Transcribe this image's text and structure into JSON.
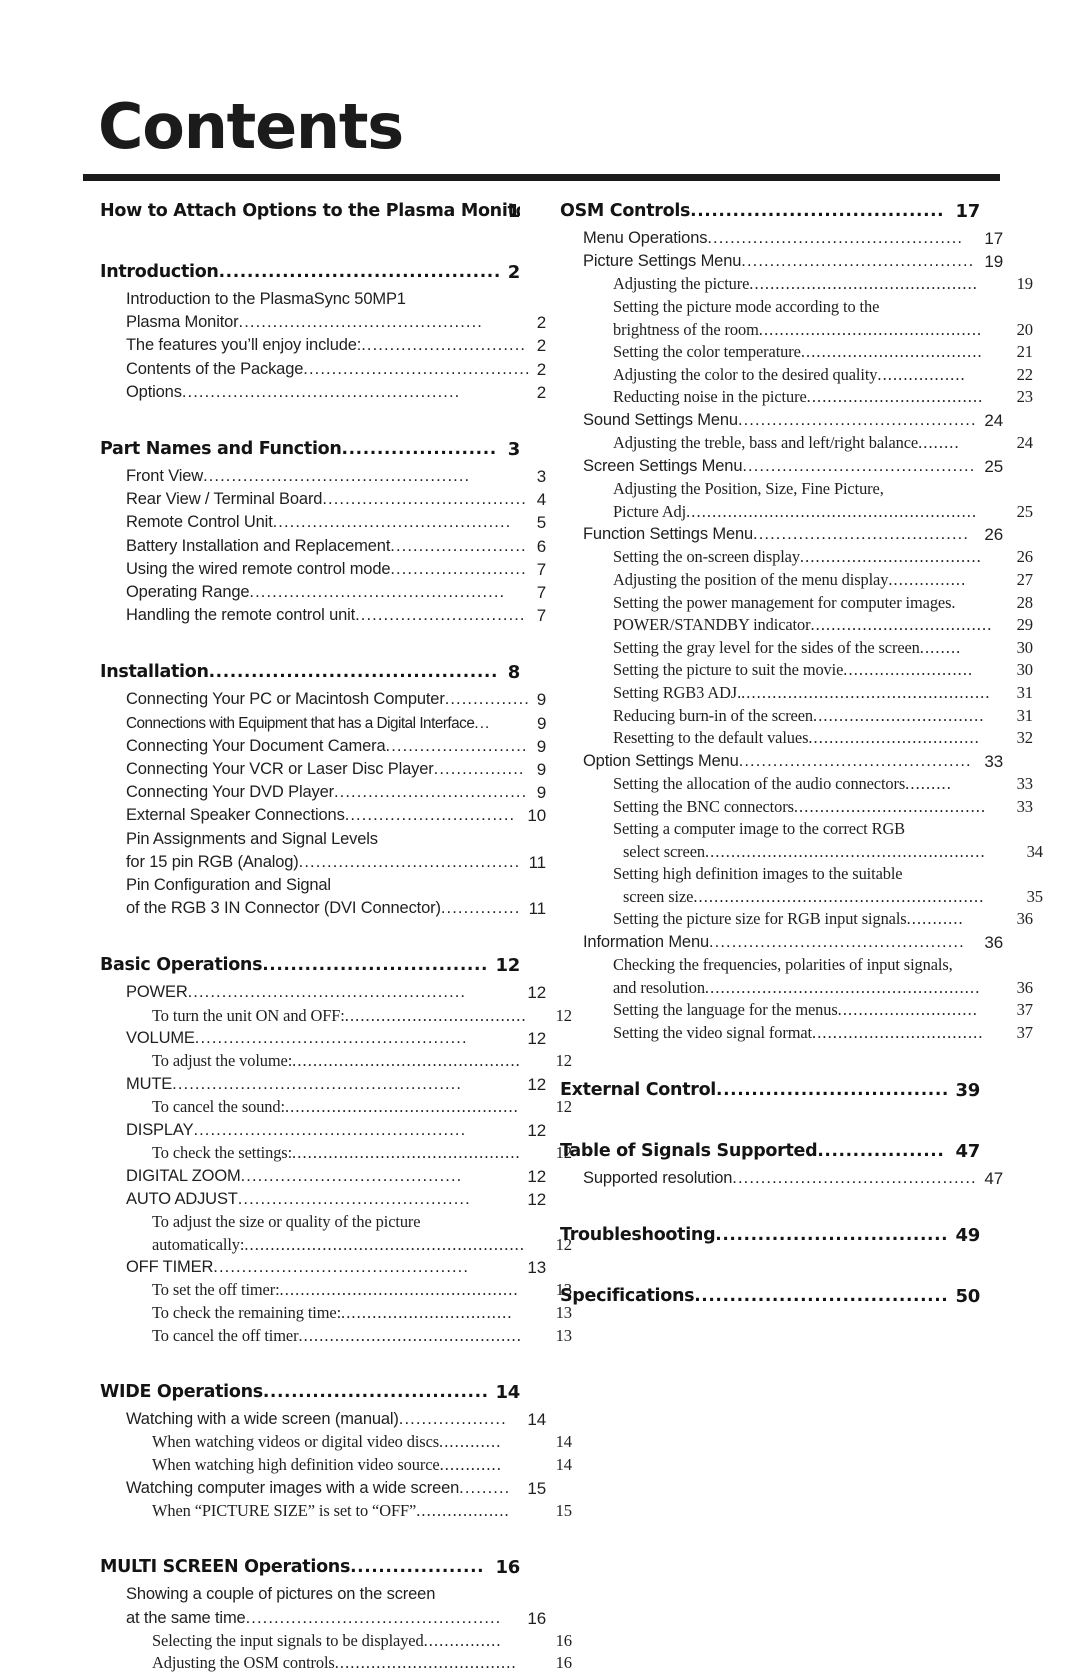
{
  "document": {
    "title": "Contents"
  },
  "columns": {
    "left": [
      {
        "level": 1,
        "text": "How to Attach Options to the Plasma Monitor",
        "page": "1",
        "dots": "...."
      },
      {
        "level": 1,
        "text": "Introduction",
        "page": "2",
        "dots": "................................................."
      },
      {
        "level": 2,
        "text": "Introduction to the PlasmaSync 50MP1",
        "page": "",
        "dots": ""
      },
      {
        "level": 2,
        "text": "Plasma Monitor",
        "page": "2",
        "dots": "..........................................."
      },
      {
        "level": 2,
        "text": "The features you’ll enjoy include:",
        "page": "2",
        "dots": "..............................."
      },
      {
        "level": 2,
        "text": "Contents of the Package",
        "page": "2",
        "dots": "........................................"
      },
      {
        "level": 2,
        "text": "Options",
        "page": "2",
        "dots": "................................................."
      },
      {
        "level": 1,
        "text": "Part Names and Function",
        "page": "3",
        "dots": "................................"
      },
      {
        "level": 2,
        "text": "Front View",
        "page": "3",
        "dots": "..............................................."
      },
      {
        "level": 2,
        "text": "Rear View / Terminal Board",
        "page": "4",
        "dots": "...................................."
      },
      {
        "level": 2,
        "text": "Remote Control Unit",
        "page": "5",
        "dots": ".........................................."
      },
      {
        "level": 2,
        "text": "Battery Installation and Replacement",
        "page": "6",
        "dots": "........................"
      },
      {
        "level": 2,
        "text": "Using the wired remote control mode",
        "page": "7",
        "dots": "........................"
      },
      {
        "level": 2,
        "text": "Operating Range",
        "page": "7",
        "dots": "............................................."
      },
      {
        "level": 2,
        "text": "Handling the remote control unit",
        "page": "7",
        "dots": "..............................."
      },
      {
        "level": 1,
        "text": "Installation",
        "page": "8",
        "dots": ".................................................."
      },
      {
        "level": 2,
        "text": "Connecting Your PC or Macintosh Computer",
        "page": "9",
        "dots": "..............."
      },
      {
        "level": 2,
        "text": "Connections with Equipment that has a Digital Interface",
        "page": "9",
        "dots": "...",
        "small": true
      },
      {
        "level": 2,
        "text": "Connecting Your Document Camera",
        "page": "9",
        "dots": ".........................."
      },
      {
        "level": 2,
        "text": "Connecting Your VCR or Laser Disc Player",
        "page": "9",
        "dots": "................."
      },
      {
        "level": 2,
        "text": "Connecting Your DVD Player",
        "page": "9",
        "dots": "...................................."
      },
      {
        "level": 2,
        "text": "External Speaker Connections",
        "page": "10",
        "dots": "................................."
      },
      {
        "level": 2,
        "text": "Pin Assignments and Signal Levels",
        "page": "",
        "dots": ""
      },
      {
        "level": 2,
        "text": "for 15 pin RGB (Analog)",
        "page": "11",
        "dots": "........................................"
      },
      {
        "level": 2,
        "text": "Pin Configuration and Signal",
        "page": "",
        "dots": ""
      },
      {
        "level": 2,
        "text": "of the RGB 3 IN Connector (DVI Connector)",
        "page": "11",
        "dots": ".............."
      },
      {
        "level": 1,
        "text": "Basic Operations",
        "page": "12",
        "dots": "..........................................."
      },
      {
        "level": 2,
        "text": "POWER",
        "page": "12",
        "dots": "................................................."
      },
      {
        "level": 3,
        "text": "To turn the unit ON and OFF:",
        "page": "12",
        "dots": "..................................."
      },
      {
        "level": 2,
        "text": "VOLUME",
        "page": "12",
        "dots": "................................................"
      },
      {
        "level": 3,
        "text": "To adjust the volume:",
        "page": "12",
        "dots": "............................................"
      },
      {
        "level": 2,
        "text": "MUTE",
        "page": "12",
        "dots": "..................................................."
      },
      {
        "level": 3,
        "text": "To cancel the sound:",
        "page": "12",
        "dots": "............................................."
      },
      {
        "level": 2,
        "text": "DISPLAY",
        "page": "12",
        "dots": "................................................"
      },
      {
        "level": 3,
        "text": "To check the settings:",
        "page": "12",
        "dots": "............................................"
      },
      {
        "level": 2,
        "text": "DIGITAL ZOOM",
        "page": "12",
        "dots": "......................................."
      },
      {
        "level": 2,
        "text": "AUTO ADJUST",
        "page": "12",
        "dots": "........................................."
      },
      {
        "level": 3,
        "text": "To adjust the size or quality of the picture",
        "page": "",
        "dots": ""
      },
      {
        "level": 3,
        "text": "automatically:",
        "page": "12",
        "dots": "......................................................"
      },
      {
        "level": 2,
        "text": "OFF TIMER",
        "page": "13",
        "dots": "............................................."
      },
      {
        "level": 3,
        "text": "To set the off timer:",
        "page": "13",
        "dots": ".............................................."
      },
      {
        "level": 3,
        "text": "To check the remaining time:",
        "page": "13",
        "dots": "................................."
      },
      {
        "level": 3,
        "text": "To cancel the off timer",
        "page": "13",
        "dots": "..........................................."
      },
      {
        "level": 1,
        "text": "WIDE Operations",
        "page": "14",
        "dots": "..........................................."
      },
      {
        "level": 2,
        "text": "Watching with a wide screen (manual)",
        "page": "14",
        "dots": "..................."
      },
      {
        "level": 3,
        "text": "When watching videos or digital video discs",
        "page": "14",
        "dots": "............"
      },
      {
        "level": 3,
        "text": "When watching high definition video source",
        "page": "14",
        "dots": "............"
      },
      {
        "level": 2,
        "text": "Watching computer images with a wide screen",
        "page": "15",
        "dots": "........."
      },
      {
        "level": 3,
        "text": "When “PICTURE SIZE” is set to “OFF”",
        "page": "15",
        "dots": ".................."
      },
      {
        "level": 1,
        "text": "MULTI SCREEN Operations",
        "page": "16",
        "dots": ".............................."
      },
      {
        "level": 2,
        "text": "Showing a couple of pictures on the screen",
        "page": "",
        "dots": ""
      },
      {
        "level": 2,
        "text": "at the same time",
        "page": "16",
        "dots": "............................................."
      },
      {
        "level": 3,
        "text": "Selecting the input signals to be displayed",
        "page": "16",
        "dots": "..............."
      },
      {
        "level": 3,
        "text": "Adjusting the OSM controls",
        "page": "16",
        "dots": "..................................."
      }
    ],
    "right": [
      {
        "level": 1,
        "text": "OSM Controls",
        "page": "17",
        "dots": "............................................."
      },
      {
        "level": 2,
        "text": "Menu Operations",
        "page": "17",
        "dots": "............................................."
      },
      {
        "level": 2,
        "text": "Picture Settings Menu",
        "page": "19",
        "dots": "........................................."
      },
      {
        "level": 3,
        "text": "Adjusting the picture",
        "page": "19",
        "dots": "............................................"
      },
      {
        "level": 3,
        "text": "Setting the picture mode according to the",
        "page": "",
        "dots": ""
      },
      {
        "level": 3,
        "text": "brightness of the room",
        "page": "20",
        "dots": "..........................................."
      },
      {
        "level": 3,
        "text": "Setting the color temperature",
        "page": "21",
        "dots": "..................................."
      },
      {
        "level": 3,
        "text": "Adjusting the color to the desired quality",
        "page": "22",
        "dots": "................."
      },
      {
        "level": 3,
        "text": "Reducting noise in the picture",
        "page": "23",
        "dots": ".................................."
      },
      {
        "level": 2,
        "text": "Sound Settings Menu",
        "page": "24",
        "dots": "..........................................."
      },
      {
        "level": 3,
        "text": "Adjusting the treble, bass and left/right balance",
        "page": "24",
        "dots": "........"
      },
      {
        "level": 2,
        "text": "Screen Settings Menu",
        "page": "25",
        "dots": ".........................................."
      },
      {
        "level": 3,
        "text": "Adjusting the Position, Size, Fine Picture,",
        "page": "",
        "dots": ""
      },
      {
        "level": 3,
        "text": "Picture Adj",
        "page": "25",
        "dots": "........................................................"
      },
      {
        "level": 2,
        "text": "Function Settings Menu",
        "page": "26",
        "dots": "......................................"
      },
      {
        "level": 3,
        "text": "Setting the on-screen display",
        "page": "26",
        "dots": "..................................."
      },
      {
        "level": 3,
        "text": "Adjusting the position of the menu display",
        "page": "27",
        "dots": "..............."
      },
      {
        "level": 3,
        "text": "Setting the power management for computer images",
        "page": "28",
        "dots": "."
      },
      {
        "level": 3,
        "text": "POWER/STANDBY indicator",
        "page": "29",
        "dots": "..................................."
      },
      {
        "level": 3,
        "text": "Setting the gray level for the sides of the screen",
        "page": "30",
        "dots": "........"
      },
      {
        "level": 3,
        "text": "Setting the picture to suit the movie",
        "page": "30",
        "dots": "........................."
      },
      {
        "level": 3,
        "text": "Setting RGB3 ADJ.",
        "page": "31",
        "dots": "................................................"
      },
      {
        "level": 3,
        "text": "Reducing burn-in of the screen",
        "page": "31",
        "dots": "................................."
      },
      {
        "level": 3,
        "text": "Resetting to the default values",
        "page": "32",
        "dots": "................................."
      },
      {
        "level": 2,
        "text": "Option Settings Menu",
        "page": "33",
        "dots": ".........................................."
      },
      {
        "level": 3,
        "text": "Setting the allocation of the audio connectors",
        "page": "33",
        "dots": "........."
      },
      {
        "level": 3,
        "text": "Setting the BNC connectors",
        "page": "33",
        "dots": "....................................."
      },
      {
        "level": 3,
        "text": "Setting a computer image to the correct RGB",
        "page": "",
        "dots": ""
      },
      {
        "level": 3,
        "text": "select screen",
        "page": "34",
        "dots": "......................................................",
        "ind": true
      },
      {
        "level": 3,
        "text": "Setting high definition images to the suitable",
        "page": "",
        "dots": ""
      },
      {
        "level": 3,
        "text": "screen size",
        "page": "35",
        "dots": "........................................................",
        "ind": true
      },
      {
        "level": 3,
        "text": "Setting the picture size for RGB input signals",
        "page": "36",
        "dots": "..........."
      },
      {
        "level": 2,
        "text": "Information Menu",
        "page": "36",
        "dots": "............................................."
      },
      {
        "level": 3,
        "text": "Checking the frequencies, polarities of input signals,",
        "page": "",
        "dots": ""
      },
      {
        "level": 3,
        "text": "and resolution",
        "page": "36",
        "dots": "....................................................."
      },
      {
        "level": 3,
        "text": "Setting the language for the menus",
        "page": "37",
        "dots": "..........................."
      },
      {
        "level": 3,
        "text": "Setting the video signal format",
        "page": "37",
        "dots": "................................."
      },
      {
        "level": 1,
        "text": "External Control",
        "page": "39",
        "dots": "............................................"
      },
      {
        "level": 1,
        "text": "Table of Signals Supported",
        "page": "47",
        "dots": "............................."
      },
      {
        "level": 2,
        "text": "Supported resolution",
        "page": "47",
        "dots": "..........................................."
      },
      {
        "level": 1,
        "text": "Troubleshooting",
        "page": "49",
        "dots": "............................................."
      },
      {
        "level": 1,
        "text": "Specifications",
        "page": "50",
        "dots": "..............................................."
      }
    ]
  }
}
